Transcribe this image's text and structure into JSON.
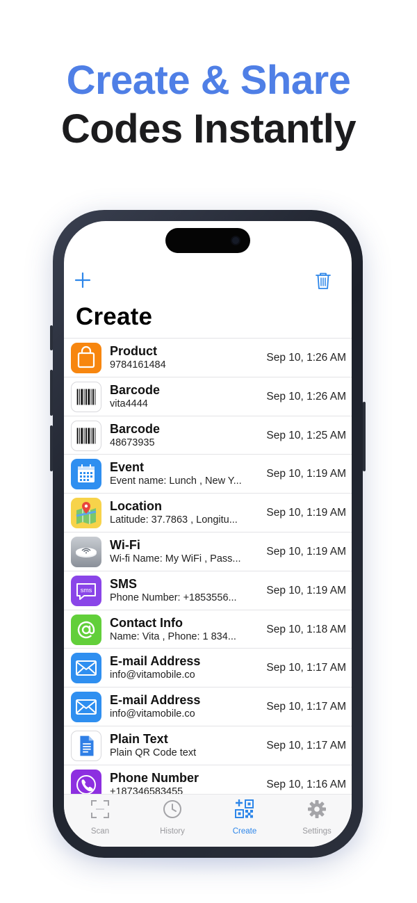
{
  "headline": {
    "line1": "Create & Share",
    "line2": "Codes Instantly"
  },
  "app": {
    "title": "Create",
    "colors": {
      "accent": "#2d86e9",
      "headline_blue": "#4f7fe6"
    },
    "icons": {
      "add": "plus-icon",
      "delete": "trash-icon"
    },
    "items": [
      {
        "type": "Product",
        "detail": "9784161484",
        "date": "Sep 10, 1:26 AM",
        "icon": "shopping-bag-icon"
      },
      {
        "type": "Barcode",
        "detail": "vita4444",
        "date": "Sep 10, 1:26 AM",
        "icon": "barcode-icon"
      },
      {
        "type": "Barcode",
        "detail": "48673935",
        "date": "Sep 10, 1:25 AM",
        "icon": "barcode-icon"
      },
      {
        "type": "Event",
        "detail": "Event name: Lunch , New Y...",
        "date": "Sep 10, 1:19 AM",
        "icon": "calendar-icon"
      },
      {
        "type": "Location",
        "detail": "Latitude: 37.7863 , Longitu...",
        "date": "Sep 10, 1:19 AM",
        "icon": "map-pin-icon"
      },
      {
        "type": "Wi-Fi",
        "detail": "Wi-fi Name: My WiFi , Pass...",
        "date": "Sep 10, 1:19 AM",
        "icon": "wifi-router-icon"
      },
      {
        "type": "SMS",
        "detail": "Phone Number: +1853556...",
        "date": "Sep 10, 1:19 AM",
        "icon": "sms-bubble-icon"
      },
      {
        "type": "Contact Info",
        "detail": "Name: Vita , Phone: 1 834...",
        "date": "Sep 10, 1:18 AM",
        "icon": "at-sign-icon"
      },
      {
        "type": "E-mail Address",
        "detail": "info@vitamobile.co",
        "date": "Sep 10, 1:17 AM",
        "icon": "envelope-icon"
      },
      {
        "type": "E-mail Address",
        "detail": "info@vitamobile.co",
        "date": "Sep 10, 1:17 AM",
        "icon": "envelope-icon"
      },
      {
        "type": "Plain Text",
        "detail": "Plain QR Code text",
        "date": "Sep 10, 1:17 AM",
        "icon": "document-icon"
      },
      {
        "type": "Phone Number",
        "detail": "+187346583455",
        "date": "Sep 10, 1:16 AM",
        "icon": "phone-icon"
      }
    ],
    "tabs": [
      {
        "label": "Scan",
        "icon": "scan-frame-icon",
        "active": false
      },
      {
        "label": "History",
        "icon": "clock-icon",
        "active": false
      },
      {
        "label": "Create",
        "icon": "qr-create-icon",
        "active": true
      },
      {
        "label": "Settings",
        "icon": "gear-icon",
        "active": false
      }
    ]
  }
}
